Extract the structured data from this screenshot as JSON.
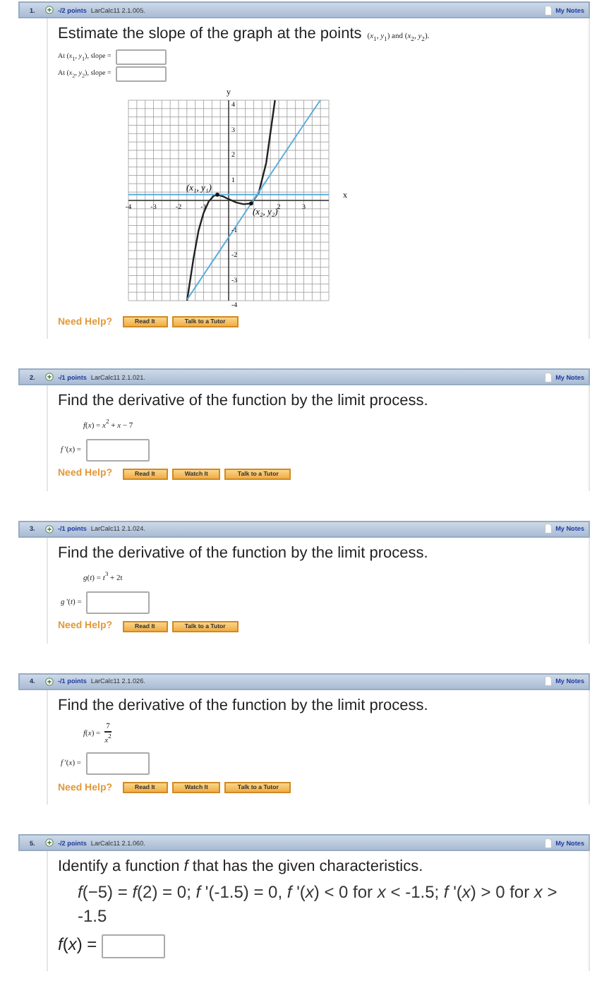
{
  "questions": [
    {
      "number": "1.",
      "points": "-/2 points",
      "source": "LarCalc11 2.1.005.",
      "notes": "My Notes",
      "prompt": "Estimate the slope of the graph at the points",
      "prompt_math": "(*x*$_{1}$, *y*$_{1}$) and (*x*$_{2}$, *y*$_{2}$).",
      "answers": [
        {
          "kind": "compact",
          "label": "At (*x*$_{1}$, *y*$_{1}$), slope ="
        },
        {
          "kind": "compact",
          "label": "At (*x*$_{2}$, *y*$_{2}$), slope ="
        }
      ],
      "chart_data": {
        "type": "line",
        "grid": true,
        "xlabel": "x",
        "ylabel": "y",
        "xlim": [
          -4,
          4
        ],
        "ylim": [
          -4,
          4
        ],
        "xticks": [
          -4,
          -3,
          -2,
          -1,
          2,
          3
        ],
        "yticks": [
          -4,
          -3,
          -2,
          -1,
          1,
          2,
          3,
          4
        ],
        "x": [
          -4,
          -1.66,
          -1.4,
          -1.2,
          -1,
          -0.8,
          -0.6,
          -0.45,
          -0.2,
          0,
          0.3,
          0.6,
          0.9,
          1.2,
          1.5,
          1.85,
          2.5,
          3,
          3.66,
          4
        ],
        "series": [
          {
            "color": "#222222",
            "values": [
              null,
              -4,
              -2.3,
              -1.2,
              -0.5,
              -0.05,
              0.18,
              0.23,
              0.15,
              0.05,
              -0.08,
              -0.15,
              -0.12,
              0.3,
              1.5,
              4,
              null,
              null,
              null,
              null
            ]
          },
          {
            "color": "#5aaedc",
            "values": [
              0.23,
              0.23,
              0.23,
              0.23,
              0.23,
              0.23,
              0.23,
              0.23,
              0.23,
              0.23,
              0.23,
              0.23,
              0.23,
              0.23,
              0.23,
              0.23,
              0.23,
              0.23,
              0.23,
              0.23
            ]
          },
          {
            "color": "#5aaedc",
            "values": [
              null,
              -3.96,
              -3.57,
              -3.27,
              -2.97,
              -2.67,
              -2.37,
              -2.15,
              -1.77,
              -1.47,
              -1.02,
              -0.57,
              -0.12,
              0.33,
              0.78,
              1.31,
              2.28,
              3.03,
              4,
              null
            ]
          }
        ],
        "annotations": [
          {
            "text": "(x₁, y₁)",
            "x": -0.45,
            "y": 0.23
          },
          {
            "text": "(x₂, y₂)",
            "x": 0.9,
            "y": -0.12
          }
        ]
      },
      "help": {
        "label": "Need Help?",
        "buttons": [
          "Read It",
          "Talk to a Tutor"
        ]
      }
    },
    {
      "number": "2.",
      "points": "-/1 points",
      "source": "LarCalc11 2.1.021.",
      "notes": "My Notes",
      "prompt": "Find the derivative of the function by the limit process.",
      "formula": {
        "kind": "inline",
        "text": "*f*(*x*) = *x*$^{2}$ + *x* − 7"
      },
      "answers": [
        {
          "kind": "block",
          "label": "*f* '(*x*) ="
        }
      ],
      "help": {
        "label": "Need Help?",
        "buttons": [
          "Read It",
          "Watch It",
          "Talk to a Tutor"
        ]
      }
    },
    {
      "number": "3.",
      "points": "-/1 points",
      "source": "LarCalc11 2.1.024.",
      "notes": "My Notes",
      "prompt": "Find the derivative of the function by the limit process.",
      "formula": {
        "kind": "inline",
        "text": "*g*(*t*) = *t*$^{3}$ + 2t"
      },
      "answers": [
        {
          "kind": "block",
          "label": "*g* '(*t*) ="
        }
      ],
      "help": {
        "label": "Need Help?",
        "buttons": [
          "Read It",
          "Talk to a Tutor"
        ]
      }
    },
    {
      "number": "4.",
      "points": "-/1 points",
      "source": "LarCalc11 2.1.026.",
      "notes": "My Notes",
      "prompt": "Find the derivative of the function by the limit process.",
      "formula": {
        "kind": "fraction",
        "lhs": "*f*(*x*) =",
        "numerator": "7",
        "denominator": "*x*$^{2}$"
      },
      "answers": [
        {
          "kind": "block",
          "label": "*f* '(*x*) ="
        }
      ],
      "help": {
        "label": "Need Help?",
        "buttons": [
          "Read It",
          "Watch It",
          "Talk to a Tutor"
        ]
      }
    },
    {
      "number": "5.",
      "points": "-/2 points",
      "source": "LarCalc11 2.1.060.",
      "notes": "My Notes",
      "prompt": "Identify a function *f* that has the given characteristics.",
      "formula": {
        "kind": "display",
        "text": "*f*(−5) = *f*(2) = 0;  *f* '(-1.5) = 0,  *f* '(*x*) < 0 for *x* < -1.5;  *f* '(*x*) > 0 for *x* > -1.5"
      },
      "answers": [
        {
          "kind": "large",
          "label": "*f*(*x*) ="
        }
      ]
    }
  ]
}
